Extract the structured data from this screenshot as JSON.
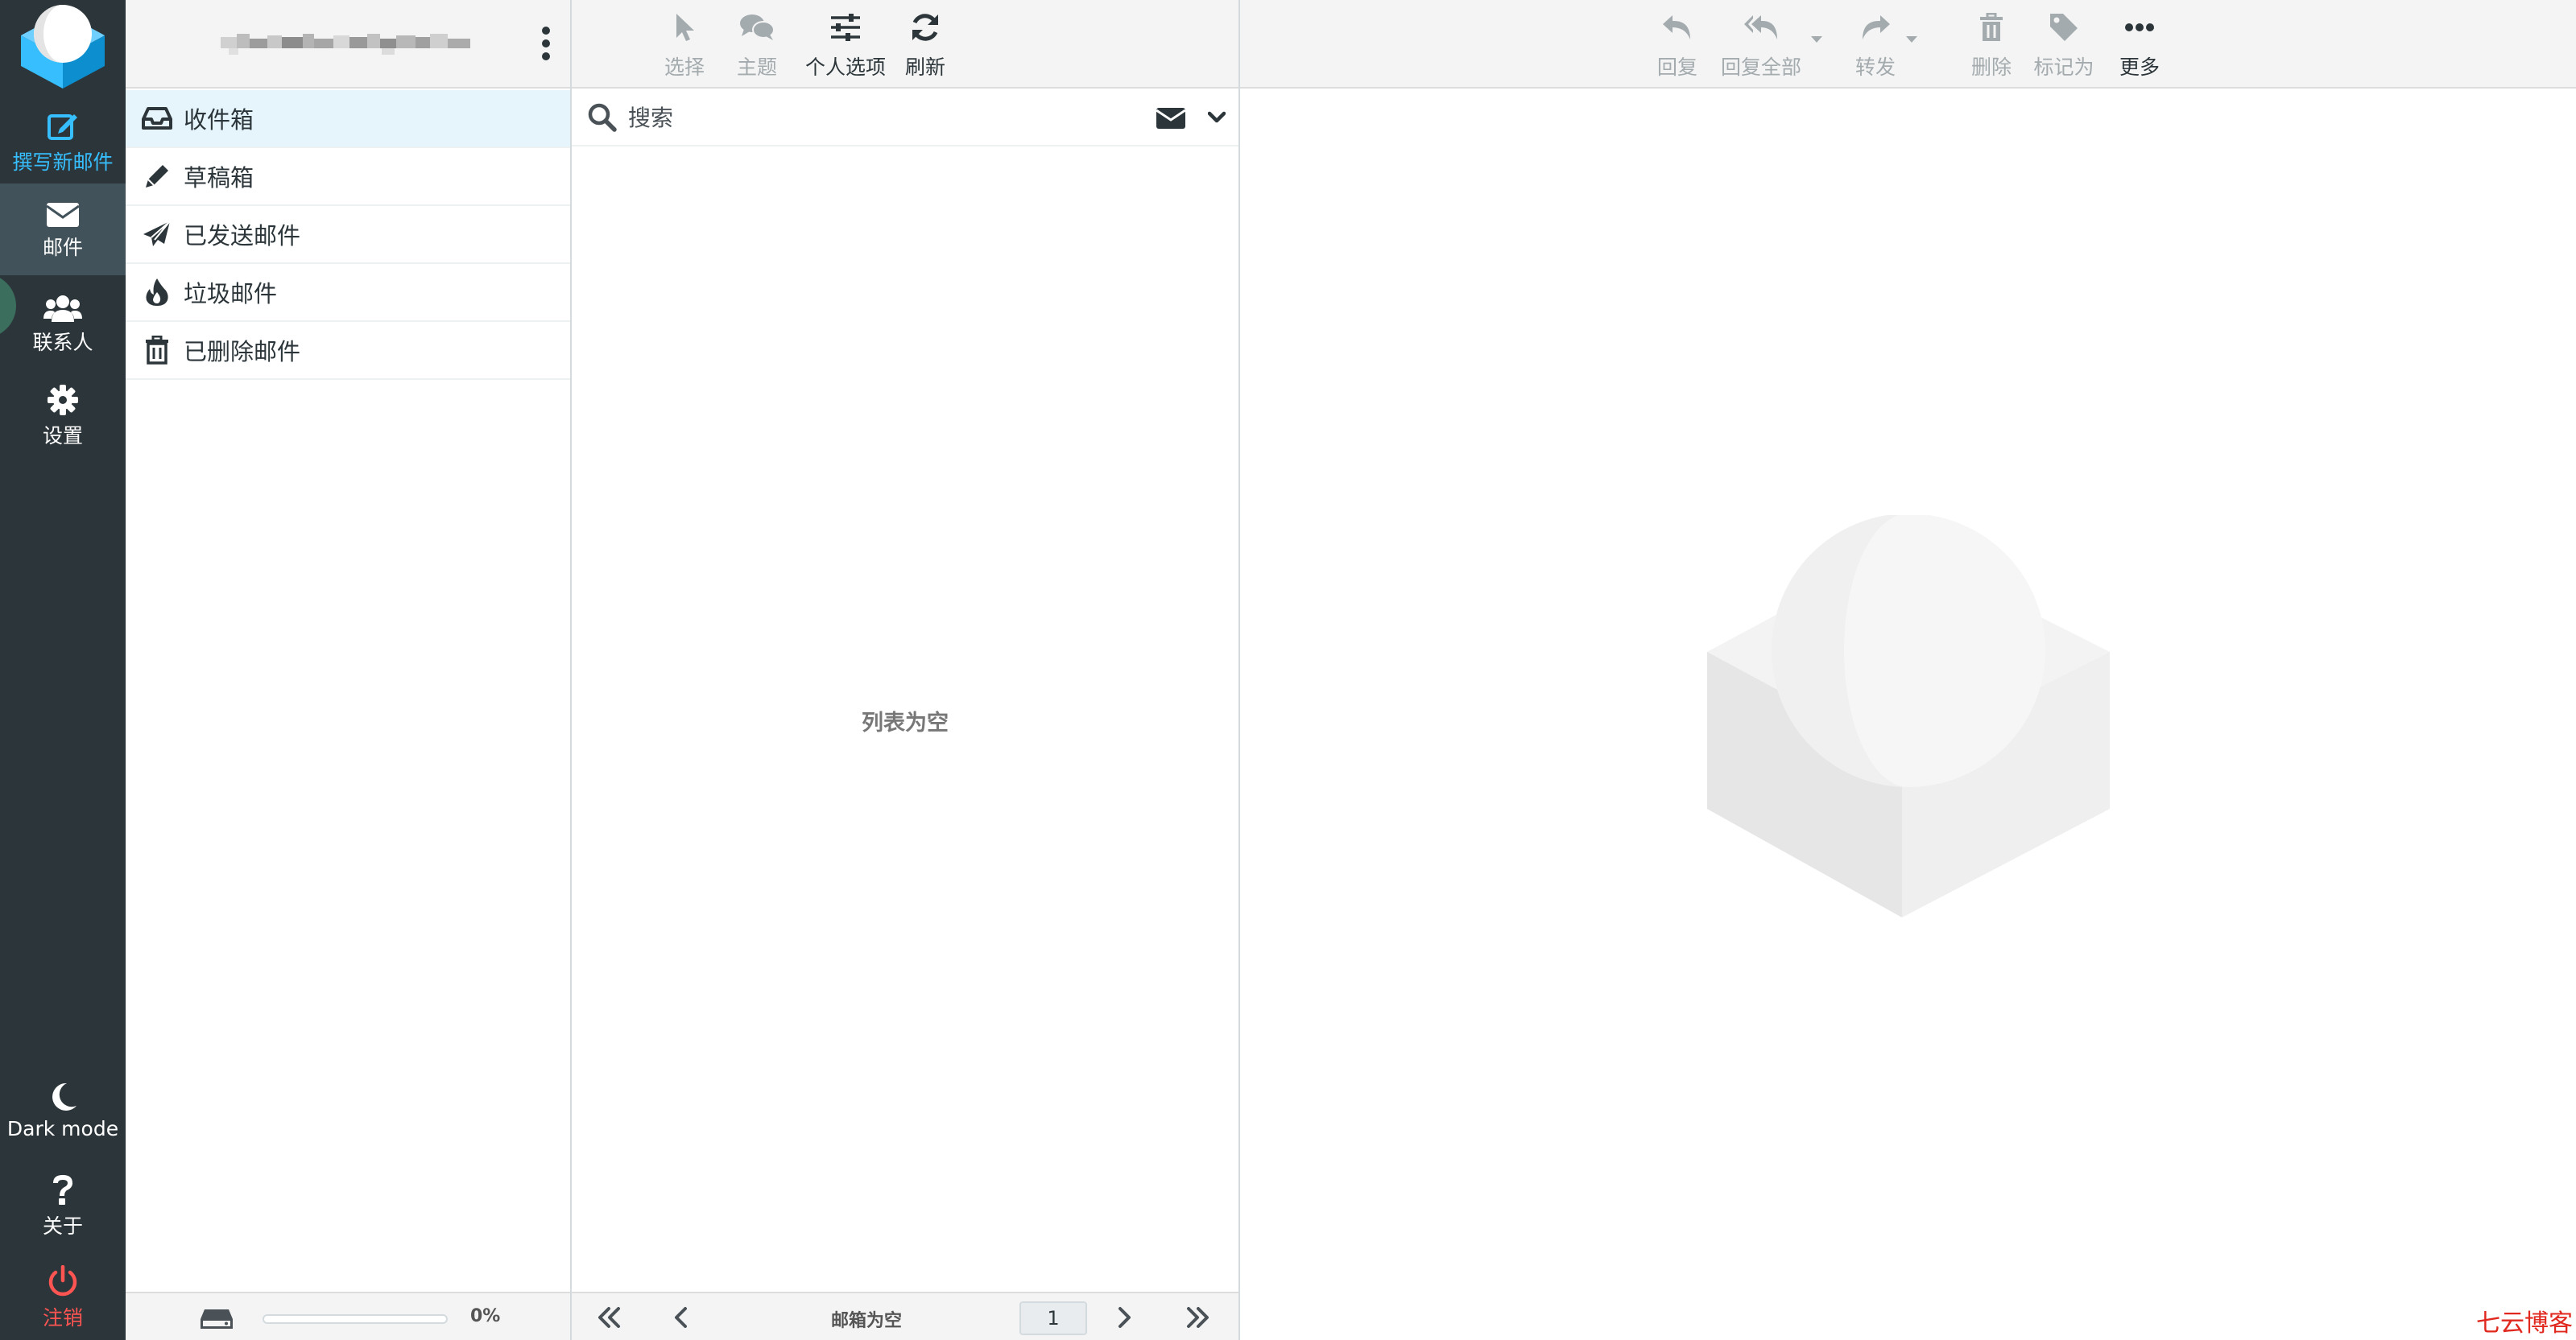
{
  "nav": {
    "compose": "撰写新邮件",
    "mail": "邮件",
    "contacts": "联系人",
    "settings": "设置",
    "dark_mode": "Dark mode",
    "about": "关于",
    "logout": "注销"
  },
  "folders": {
    "items": [
      {
        "label": "收件箱",
        "icon": "inbox-icon",
        "active": true
      },
      {
        "label": "草稿箱",
        "icon": "pencil-icon"
      },
      {
        "label": "已发送邮件",
        "icon": "paper-plane-icon"
      },
      {
        "label": "垃圾邮件",
        "icon": "fire-icon"
      },
      {
        "label": "已删除邮件",
        "icon": "trash-icon"
      }
    ],
    "quota_text": "0%",
    "quota_fraction": 0
  },
  "list": {
    "toolbar": {
      "select": "选择",
      "threads": "主题",
      "options": "个人选项",
      "refresh": "刷新"
    },
    "search_placeholder": "搜索",
    "empty_message": "列表为空",
    "count_text": "邮箱为空",
    "page": "1"
  },
  "reader": {
    "toolbar": {
      "reply": "回复",
      "reply_all": "回复全部",
      "forward": "转发",
      "delete": "删除",
      "mark": "标记为",
      "more": "更多"
    }
  },
  "watermark": "七云博客",
  "colors": {
    "rail_bg": "#2c363a",
    "accent": "#37beff",
    "logout": "#ff5552",
    "active_folder": "#e6f5fc"
  }
}
